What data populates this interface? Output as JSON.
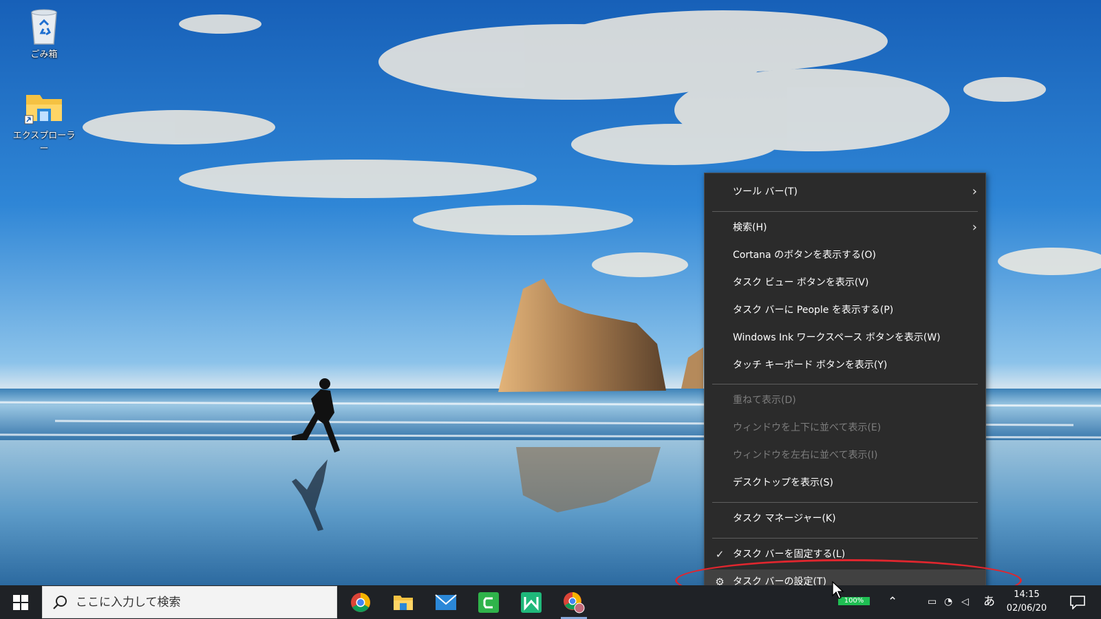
{
  "desktop": {
    "icons": [
      {
        "label": "ごみ箱",
        "icon": "recycle-bin-icon"
      },
      {
        "label": "エクスプローラー",
        "icon": "file-explorer-shortcut-icon"
      }
    ]
  },
  "context_menu": {
    "items": [
      {
        "label": "ツール バー(T)",
        "submenu": true,
        "enabled": true
      },
      {
        "label": "検索(H)",
        "submenu": true,
        "enabled": true
      },
      {
        "label": "Cortana のボタンを表示する(O)",
        "enabled": true
      },
      {
        "label": "タスク ビュー ボタンを表示(V)",
        "enabled": true
      },
      {
        "label": "タスク バーに People を表示する(P)",
        "enabled": true
      },
      {
        "label": "Windows Ink ワークスペース ボタンを表示(W)",
        "enabled": true
      },
      {
        "label": "タッチ キーボード ボタンを表示(Y)",
        "enabled": true
      },
      {
        "label": "重ねて表示(D)",
        "enabled": false
      },
      {
        "label": "ウィンドウを上下に並べて表示(E)",
        "enabled": false
      },
      {
        "label": "ウィンドウを左右に並べて表示(I)",
        "enabled": false
      },
      {
        "label": "デスクトップを表示(S)",
        "enabled": true
      },
      {
        "label": "タスク マネージャー(K)",
        "enabled": true
      },
      {
        "label": "タスク バーを固定する(L)",
        "checked": true,
        "enabled": true
      },
      {
        "label": "タスク バーの設定(T)",
        "icon": "gear-icon",
        "enabled": true,
        "highlighted": true
      }
    ],
    "arrow_glyph": "›",
    "check_glyph": "✓",
    "gear_glyph": "⚙"
  },
  "taskbar": {
    "search_placeholder": "ここに入力して検索",
    "apps": [
      {
        "name": "Google Chrome",
        "icon": "chrome-icon"
      },
      {
        "name": "エクスプローラー",
        "icon": "file-explorer-icon"
      },
      {
        "name": "メール",
        "icon": "mail-icon"
      },
      {
        "name": "Camtasia",
        "icon": "camtasia-icon"
      },
      {
        "name": "XMind",
        "icon": "xmind-icon"
      },
      {
        "name": "Chrome (user)",
        "icon": "chrome-profile-icon",
        "active": true
      }
    ],
    "tray": {
      "battery_text": "100%",
      "ime_text": "あ",
      "time": "14:15",
      "date": "02/06/20"
    }
  },
  "colors": {
    "menu_bg": "#2b2b2b",
    "menu_highlight": "#414141",
    "annotation": "#e0262e",
    "taskbar_bg": "#1f2226"
  }
}
